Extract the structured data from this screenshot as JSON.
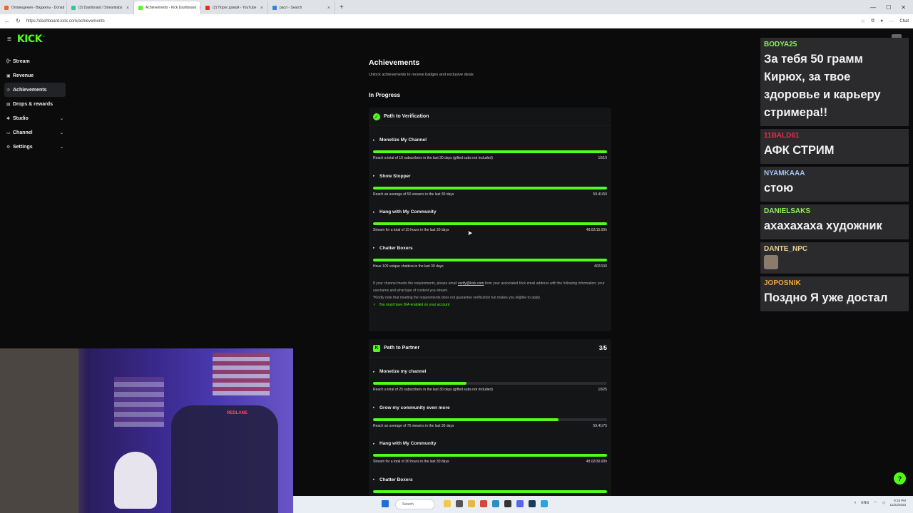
{
  "browser": {
    "tabs": [
      {
        "label": "Оповещения - Виджеты · Donati"
      },
      {
        "label": "(3) Dashboard / Streamlabs"
      },
      {
        "label": "Achievements - Kick Dashboard"
      },
      {
        "label": "(2) Порог домой - YouTube"
      },
      {
        "label": "расл - Search"
      }
    ],
    "active_tab": 2,
    "new_tab": "+",
    "url": "https://dashboard.kick.com/achievements",
    "chat_button": "Chat"
  },
  "sidebar": {
    "logo": "KICK",
    "items": [
      {
        "label": "Stream",
        "icon": "broadcast-icon",
        "chev": ""
      },
      {
        "label": "Revenue",
        "icon": "revenue-icon",
        "chev": ""
      },
      {
        "label": "Achievements",
        "icon": "trophy-icon",
        "chev": ""
      },
      {
        "label": "Drops & rewards",
        "icon": "gift-icon",
        "chev": ""
      },
      {
        "label": "Studio",
        "icon": "studio-icon",
        "chev": "⌄"
      },
      {
        "label": "Channel",
        "icon": "channel-icon",
        "chev": "⌄"
      },
      {
        "label": "Settings",
        "icon": "gear-icon",
        "chev": "⌄"
      }
    ]
  },
  "page": {
    "title": "Achievements",
    "subtitle": "Unlock achievements to receive badges and exclusive deals",
    "section": "In Progress"
  },
  "verification": {
    "title": "Path to Verification",
    "tasks": [
      {
        "name": "Monetize My Channel",
        "desc": "Reach a total of 10 subscribers in the last 30 days (gifted subs not included)",
        "progress": "10/10",
        "fill": 1.0
      },
      {
        "name": "Show Stopper",
        "desc": "Reach an average of 50 viewers in the last 30 days",
        "progress": "59.41/50",
        "fill": 1.0
      },
      {
        "name": "Hang with My Community",
        "desc": "Stream for a total of 15 hours in the last 30 days",
        "progress": "48.02/15.00h",
        "fill": 1.0
      },
      {
        "name": "Chatter Boxers",
        "desc": "Have 100 unique chatters in the last 30 days",
        "progress": "402/100",
        "fill": 1.0
      }
    ],
    "note_prefix": "If your channel meets the requirements, please email ",
    "note_email": "verify@kick.com",
    "note_suffix": " from your associated Kick email address with the following information: your username and what type of content you stream.",
    "note_disclaimer": "*Kindly note that meeting the requirements does not guarantee verification but makes you eligible to apply.",
    "twofa": "You must have 2FA enabled on your account"
  },
  "partner": {
    "title": "Path to Partner",
    "count": "3/5",
    "tasks": [
      {
        "name": "Monetize my channel",
        "desc": "Reach a total of 25 subscribers in the last 30 days (gifted subs not included)",
        "progress": "10/25",
        "fill": 0.4
      },
      {
        "name": "Grow my community even more",
        "desc": "Reach an average of 75 viewers in the last 30 days",
        "progress": "59.41/75",
        "fill": 0.792
      },
      {
        "name": "Hang with My Community",
        "desc": "Stream for a total of 30 hours in the last 30 days",
        "progress": "48.02/30.00h",
        "fill": 1.0
      },
      {
        "name": "Chatter Boxers",
        "desc": "",
        "progress": "",
        "fill": 1.0
      }
    ]
  },
  "chat": [
    {
      "user": "BODYA25",
      "color": "#8ff05a",
      "text": "За тебя 50 грамм Кирюх, за твое здоровье и карьеру стримера!!"
    },
    {
      "user": "11BALD61",
      "color": "#e0304a",
      "text": "АФК СТРИМ"
    },
    {
      "user": "NYAMKAAA",
      "color": "#9ec3f0",
      "text": "стою"
    },
    {
      "user": "DANIELSAKS",
      "color": "#8ff05a",
      "text": "ахахахаха художник"
    },
    {
      "user": "DANTE_NPC",
      "color": "#f0d08a",
      "text": ""
    },
    {
      "user": "JOPOSNIK",
      "color": "#f0a24a",
      "text": "Поздно Я уже достал"
    }
  ],
  "webcam": {
    "sign": "REDLANE"
  },
  "taskbar": {
    "search": "Search",
    "lang": "ENG",
    "time": "8:18 PM",
    "date": "12/22/2023"
  },
  "colors": {
    "accent": "#53fc18",
    "bg": "#0b0b0c",
    "card": "#141517"
  }
}
